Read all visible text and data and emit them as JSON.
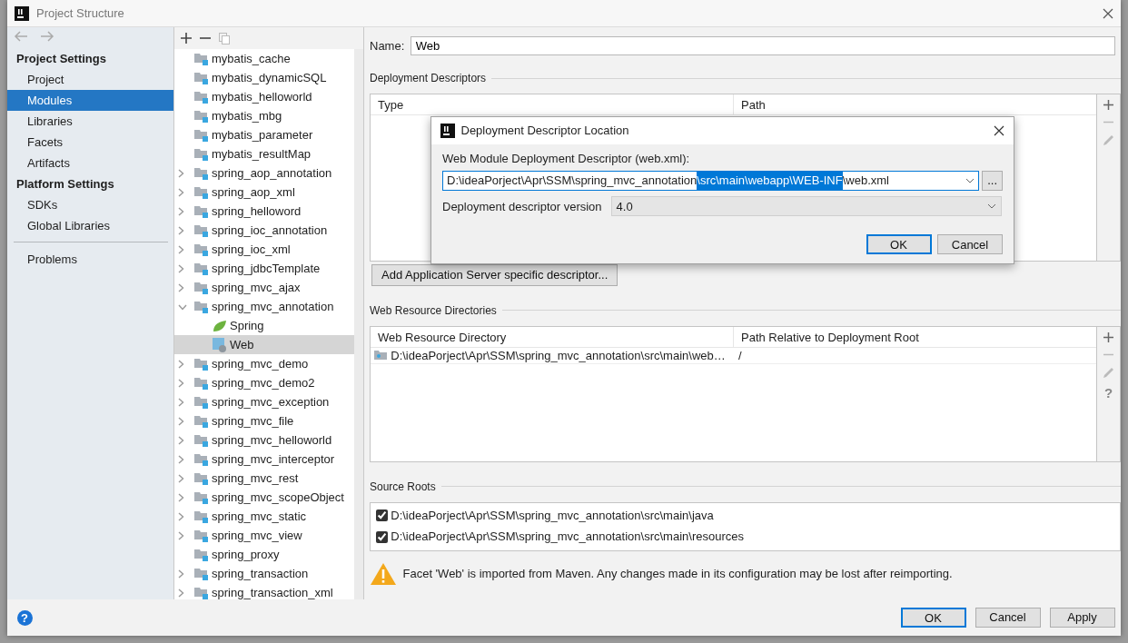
{
  "window": {
    "title": "Project Structure"
  },
  "sidebar": {
    "sections": [
      {
        "heading": "Project Settings",
        "items": [
          {
            "label": "Project",
            "selected": false
          },
          {
            "label": "Modules",
            "selected": true
          },
          {
            "label": "Libraries",
            "selected": false
          },
          {
            "label": "Facets",
            "selected": false
          },
          {
            "label": "Artifacts",
            "selected": false
          }
        ]
      },
      {
        "heading": "Platform Settings",
        "items": [
          {
            "label": "SDKs",
            "selected": false
          },
          {
            "label": "Global Libraries",
            "selected": false
          }
        ]
      }
    ],
    "footer_items": [
      {
        "label": "Problems",
        "selected": false
      }
    ]
  },
  "tree": {
    "items": [
      {
        "label": "mybatis_cache",
        "kind": "module",
        "selected": false
      },
      {
        "label": "mybatis_dynamicSQL",
        "kind": "module",
        "selected": false
      },
      {
        "label": "mybatis_helloworld",
        "kind": "module",
        "selected": false
      },
      {
        "label": "mybatis_mbg",
        "kind": "module",
        "selected": false
      },
      {
        "label": "mybatis_parameter",
        "kind": "module",
        "selected": false
      },
      {
        "label": "mybatis_resultMap",
        "kind": "module",
        "selected": false
      },
      {
        "label": "spring_aop_annotation",
        "kind": "collapsed-module",
        "selected": false
      },
      {
        "label": "spring_aop_xml",
        "kind": "collapsed-module",
        "selected": false
      },
      {
        "label": "spring_helloword",
        "kind": "collapsed-module",
        "selected": false
      },
      {
        "label": "spring_ioc_annotation",
        "kind": "collapsed-module",
        "selected": false
      },
      {
        "label": "spring_ioc_xml",
        "kind": "collapsed-module",
        "selected": false
      },
      {
        "label": "spring_jdbcTemplate",
        "kind": "collapsed-module",
        "selected": false
      },
      {
        "label": "spring_mvc_ajax",
        "kind": "collapsed-module",
        "selected": false
      },
      {
        "label": "spring_mvc_annotation",
        "kind": "expanded-module",
        "selected": false,
        "children": [
          {
            "label": "Spring",
            "kind": "spring",
            "selected": false
          },
          {
            "label": "Web",
            "kind": "web",
            "selected": true
          }
        ]
      },
      {
        "label": "spring_mvc_demo",
        "kind": "collapsed-module",
        "selected": false
      },
      {
        "label": "spring_mvc_demo2",
        "kind": "collapsed-module",
        "selected": false
      },
      {
        "label": "spring_mvc_exception",
        "kind": "collapsed-module",
        "selected": false
      },
      {
        "label": "spring_mvc_file",
        "kind": "collapsed-module",
        "selected": false
      },
      {
        "label": "spring_mvc_helloworld",
        "kind": "collapsed-module",
        "selected": false
      },
      {
        "label": "spring_mvc_interceptor",
        "kind": "collapsed-module",
        "selected": false
      },
      {
        "label": "spring_mvc_rest",
        "kind": "collapsed-module",
        "selected": false
      },
      {
        "label": "spring_mvc_scopeObject",
        "kind": "collapsed-module",
        "selected": false
      },
      {
        "label": "spring_mvc_static",
        "kind": "collapsed-module",
        "selected": false
      },
      {
        "label": "spring_mvc_view",
        "kind": "collapsed-module",
        "selected": false
      },
      {
        "label": "spring_proxy",
        "kind": "module",
        "selected": false
      },
      {
        "label": "spring_transaction",
        "kind": "collapsed-module",
        "selected": false
      },
      {
        "label": "spring_transaction_xml",
        "kind": "collapsed-module",
        "selected": false
      }
    ]
  },
  "facet": {
    "name_label": "Name:",
    "name": "Web",
    "descriptors": {
      "title": "Deployment Descriptors",
      "columns": [
        "Type",
        "Path"
      ],
      "add_button": "Add Application Server specific descriptor..."
    },
    "resource_dirs": {
      "title": "Web Resource Directories",
      "columns": [
        "Web Resource Directory",
        "Path Relative to Deployment Root"
      ],
      "rows": [
        {
          "directory": "D:\\ideaPorject\\Apr\\SSM\\spring_mvc_annotation\\src\\main\\web…",
          "path": "/"
        }
      ],
      "help": "?"
    },
    "source_roots": {
      "title": "Source Roots",
      "items": [
        {
          "path": "D:\\ideaPorject\\Apr\\SSM\\spring_mvc_annotation\\src\\main\\java",
          "checked": true
        },
        {
          "path": "D:\\ideaPorject\\Apr\\SSM\\spring_mvc_annotation\\src\\main\\resources",
          "checked": true
        }
      ]
    },
    "warning": "Facet 'Web' is imported from Maven. Any changes made in its configuration may be lost after reimporting."
  },
  "dialog": {
    "title": "Deployment Descriptor Location",
    "field_label": "Web Module Deployment Descriptor (web.xml):",
    "path_parts": [
      {
        "text": "D:\\ideaPorject\\Apr\\SSM\\spring_mvc_annotation",
        "selected": false
      },
      {
        "text": "\\src\\main\\webapp\\WEB-INF",
        "selected": true
      },
      {
        "text": "\\web.xml",
        "selected": false
      }
    ],
    "browse_button": "...",
    "version_label": "Deployment descriptor version",
    "version": "4.0",
    "buttons": [
      {
        "label": "OK",
        "default": true
      },
      {
        "label": "Cancel",
        "default": false
      }
    ]
  },
  "footer": {
    "help": "?",
    "buttons": [
      {
        "label": "OK",
        "default": true
      },
      {
        "label": "Cancel",
        "default": false
      },
      {
        "label": "Apply",
        "default": false
      }
    ]
  }
}
